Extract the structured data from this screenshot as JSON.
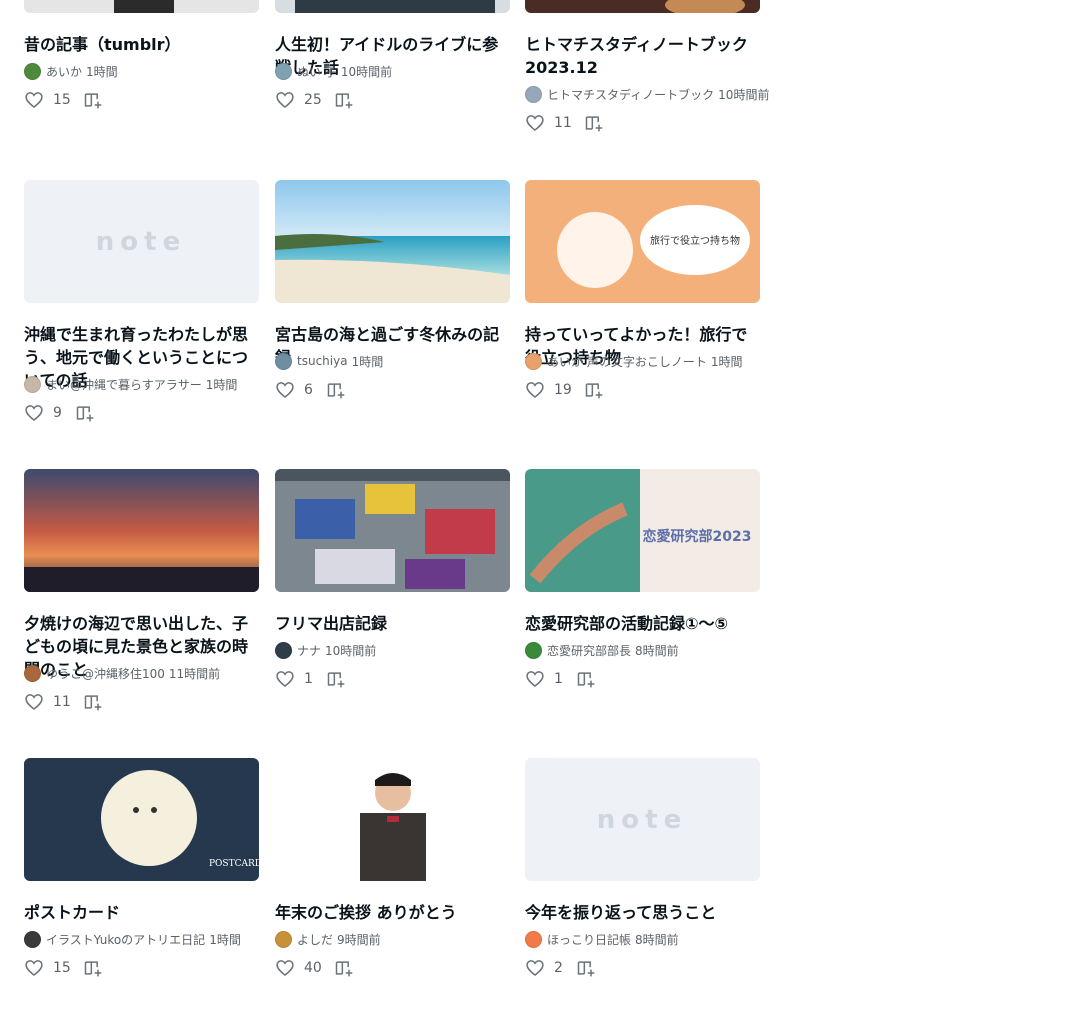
{
  "colors": {
    "text": "#08131a",
    "muted": "#5a6268",
    "icon": "#6b7378",
    "placeholder": "#eef2f6"
  },
  "cards": [
    {
      "title": "昔の記事（tumblr）",
      "author": "あいか",
      "time": "1時間",
      "likes": "15",
      "thumb": "manga",
      "avatar": "#4f8a3c"
    },
    {
      "title": "人生初！アイドルのライブに参戦した話",
      "author": "ぬい 子",
      "time": "10時間前",
      "likes": "25",
      "thumb": "dark-illust",
      "avatar": "#7fa1b0"
    },
    {
      "title": "ヒトマチスタディノートブック 2023.12",
      "author": "ヒトマチスタディノートブック",
      "time": "10時間前",
      "likes": "11",
      "thumb": "food",
      "avatar": "#95a7b8"
    },
    {
      "title": "沖縄で生まれ育ったわたしが思う、地元で働くということについての話",
      "author": "まい@沖縄で暮らすアラサー",
      "time": "1時間",
      "likes": "9",
      "thumb": "note",
      "avatar": "#c6b7a6"
    },
    {
      "title": "宮古島の海と過ごす冬休みの記録",
      "author": "tsuchiya",
      "time": "1時間",
      "likes": "6",
      "thumb": "beach",
      "avatar": "#6f8ea0"
    },
    {
      "title": "持っていってよかった！旅行で役立つ持ち物",
      "author": "あいか 声の文字おこしノート",
      "time": "1時間",
      "likes": "19",
      "thumb": "illust-bag",
      "avatar": "#e8a16a"
    },
    {
      "title": "夕焼けの海辺で思い出した、子どもの頃に見た景色と家族の時間のこと",
      "author": "ゆうこ@沖縄移住100",
      "time": "11時間前",
      "likes": "11",
      "thumb": "sunset",
      "avatar": "#a8673c"
    },
    {
      "title": "フリマ出店記録",
      "author": "ナナ",
      "time": "10時間前",
      "likes": "1",
      "thumb": "flea",
      "avatar": "#2f3d4a"
    },
    {
      "title": "恋愛研究部の活動記録①〜⑤",
      "author": "恋愛研究部部長",
      "time": "8時間前",
      "likes": "1",
      "thumb": "love",
      "avatar": "#3b8a3a"
    },
    {
      "title": "ポストカード",
      "author": "イラストYukoのアトリエ日記",
      "time": "1時間",
      "likes": "15",
      "thumb": "moon",
      "avatar": "#3a3a3a"
    },
    {
      "title": "年末のご挨拶 ありがとう",
      "author": "よしだ",
      "time": "9時間前",
      "likes": "40",
      "thumb": "portrait",
      "avatar": "#c7913a"
    },
    {
      "title": "今年を振り返って思うこと",
      "author": "ほっこり日記帳",
      "time": "8時間前",
      "likes": "2",
      "thumb": "note",
      "avatar": "#f07a4a"
    }
  ]
}
